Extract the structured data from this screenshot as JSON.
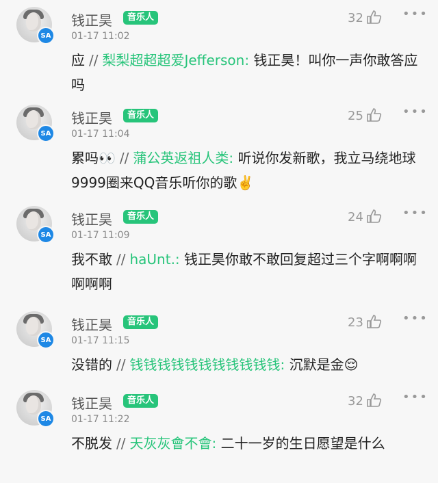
{
  "comments": [
    {
      "username": "钱正昊",
      "tag": "音乐人",
      "time": "01-17 11:02",
      "likes": "32",
      "reply": "应",
      "separator": "//",
      "mention": "梨梨超超超爱Jefferson:",
      "quoted": "钱正昊！叫你一声你敢答应吗"
    },
    {
      "username": "钱正昊",
      "tag": "音乐人",
      "time": "01-17 11:04",
      "likes": "25",
      "reply": "累吗👀",
      "separator": "//",
      "mention": "蒲公英返祖人类:",
      "quoted": "听说你发新歌，我立马绕地球9999圈来QQ音乐听你的歌✌️"
    },
    {
      "username": "钱正昊",
      "tag": "音乐人",
      "time": "01-17 11:09",
      "likes": "24",
      "reply": "我不敢",
      "separator": "//",
      "mention": "haUnt.:",
      "quoted": "钱正昊你敢不敢回复超过三个字啊啊啊啊啊啊"
    },
    {
      "username": "钱正昊",
      "tag": "音乐人",
      "time": "01-17 11:15",
      "likes": "23",
      "reply": "没错的",
      "separator": "//",
      "mention": "钱钱钱钱钱钱钱钱钱钱钱:",
      "quoted": "沉默是金😌"
    },
    {
      "username": "钱正昊",
      "tag": "音乐人",
      "time": "01-17 11:22",
      "likes": "32",
      "reply": "不脱发",
      "separator": "//",
      "mention": "天灰灰會不會:",
      "quoted": "二十一岁的生日愿望是什么"
    }
  ],
  "icons": {
    "avatar_badge": "SA",
    "like": "thumbs-up-icon",
    "more": "more-dots-icon"
  },
  "colors": {
    "accent": "#27c47a",
    "badge": "#1e88e5"
  }
}
